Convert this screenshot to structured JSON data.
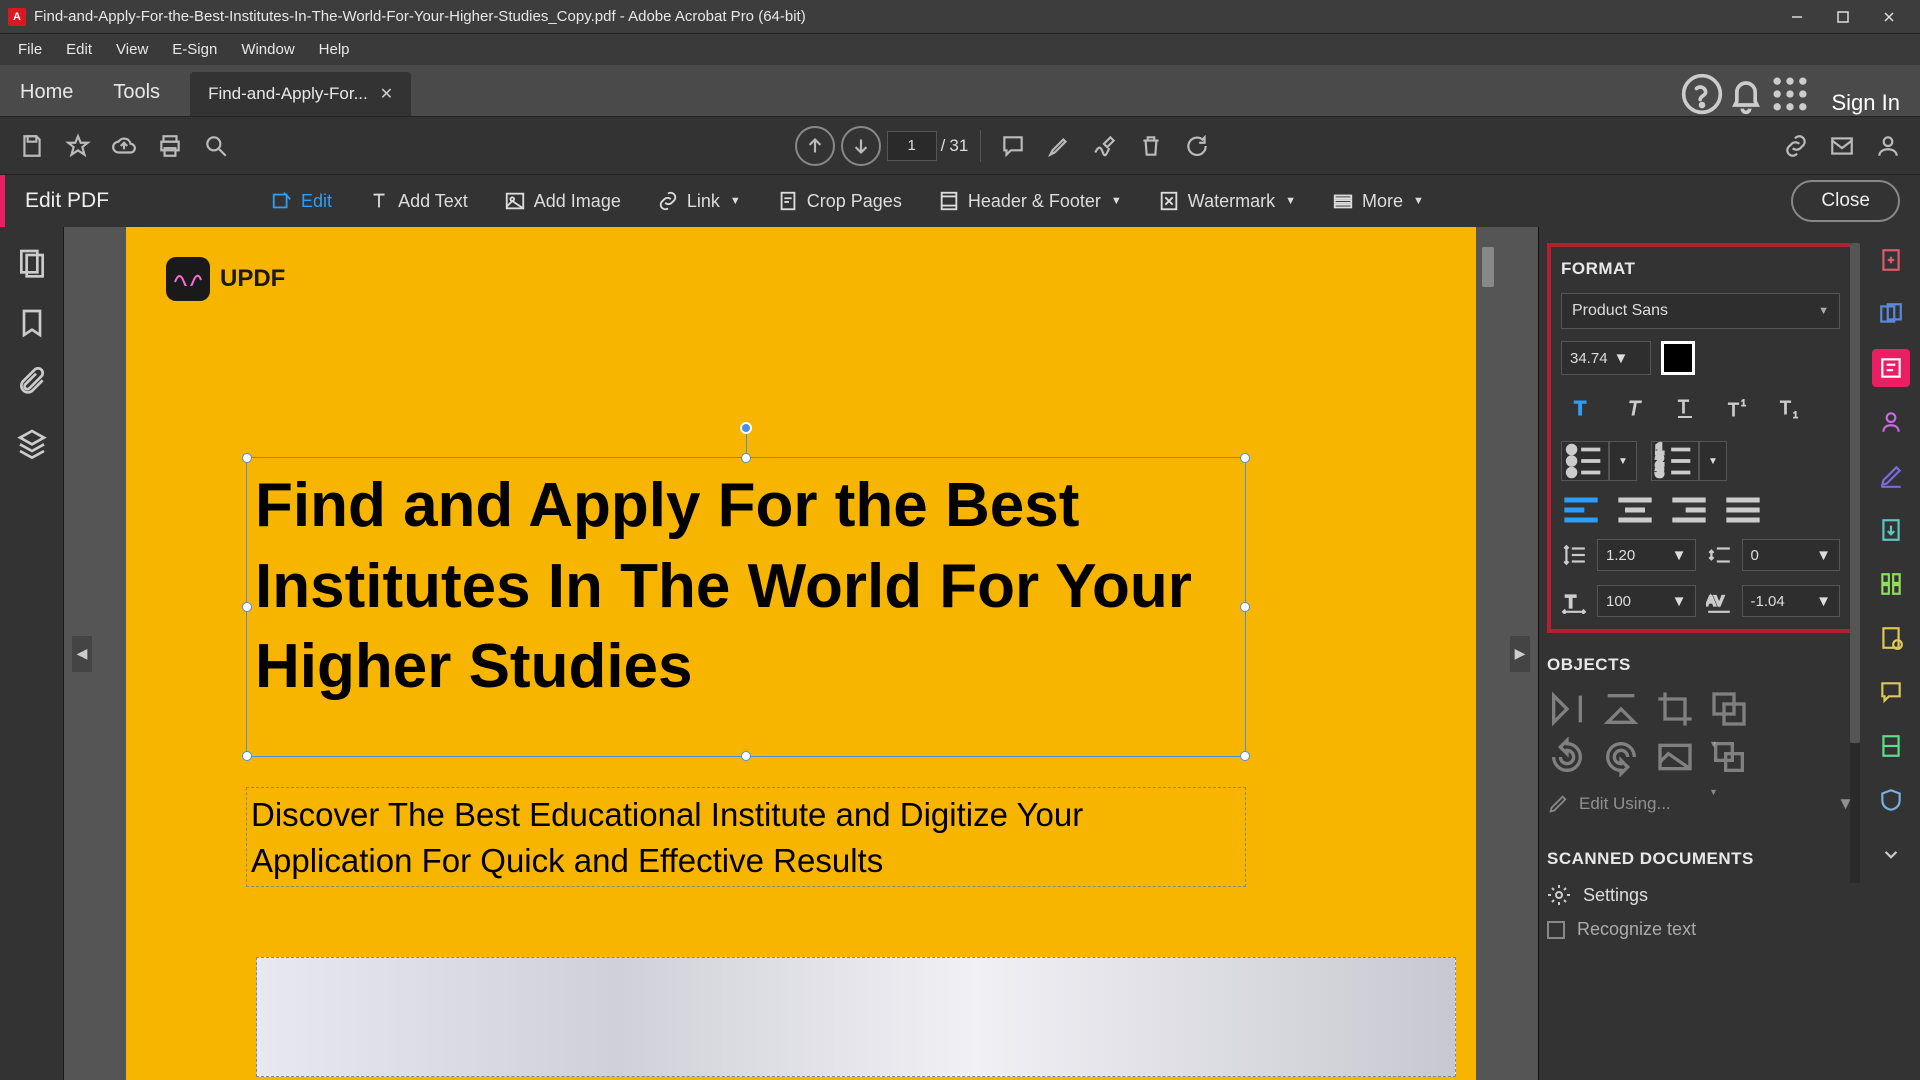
{
  "title": "Find-and-Apply-For-the-Best-Institutes-In-The-World-For-Your-Higher-Studies_Copy.pdf - Adobe Acrobat Pro (64-bit)",
  "menu": {
    "file": "File",
    "edit": "Edit",
    "view": "View",
    "esign": "E-Sign",
    "window": "Window",
    "help": "Help"
  },
  "tabs": {
    "home": "Home",
    "tools": "Tools",
    "doc": "Find-and-Apply-For...",
    "sign_in": "Sign In"
  },
  "toolbar": {
    "page_current": "1",
    "page_sep": "/",
    "page_total": "31"
  },
  "editbar": {
    "title": "Edit PDF",
    "edit": "Edit",
    "add_text": "Add Text",
    "add_image": "Add Image",
    "link": "Link",
    "crop": "Crop Pages",
    "header_footer": "Header & Footer",
    "watermark": "Watermark",
    "more": "More",
    "close": "Close"
  },
  "page": {
    "logo_text": "UPDF",
    "heading": "Find and Apply For the Best Institutes In The World For Your Higher Studies",
    "subheading": "Discover The Best Educational Institute and Digitize Your Application For Quick and Effective Results"
  },
  "format": {
    "title": "FORMAT",
    "font": "Product Sans",
    "size": "34.74",
    "line_spacing": "1.20",
    "para_spacing": "0",
    "horiz_scale": "100",
    "char_spacing": "-1.04"
  },
  "objects": {
    "title": "OBJECTS",
    "edit_using": "Edit Using..."
  },
  "scanned": {
    "title": "SCANNED DOCUMENTS",
    "settings": "Settings",
    "recognize": "Recognize text"
  }
}
